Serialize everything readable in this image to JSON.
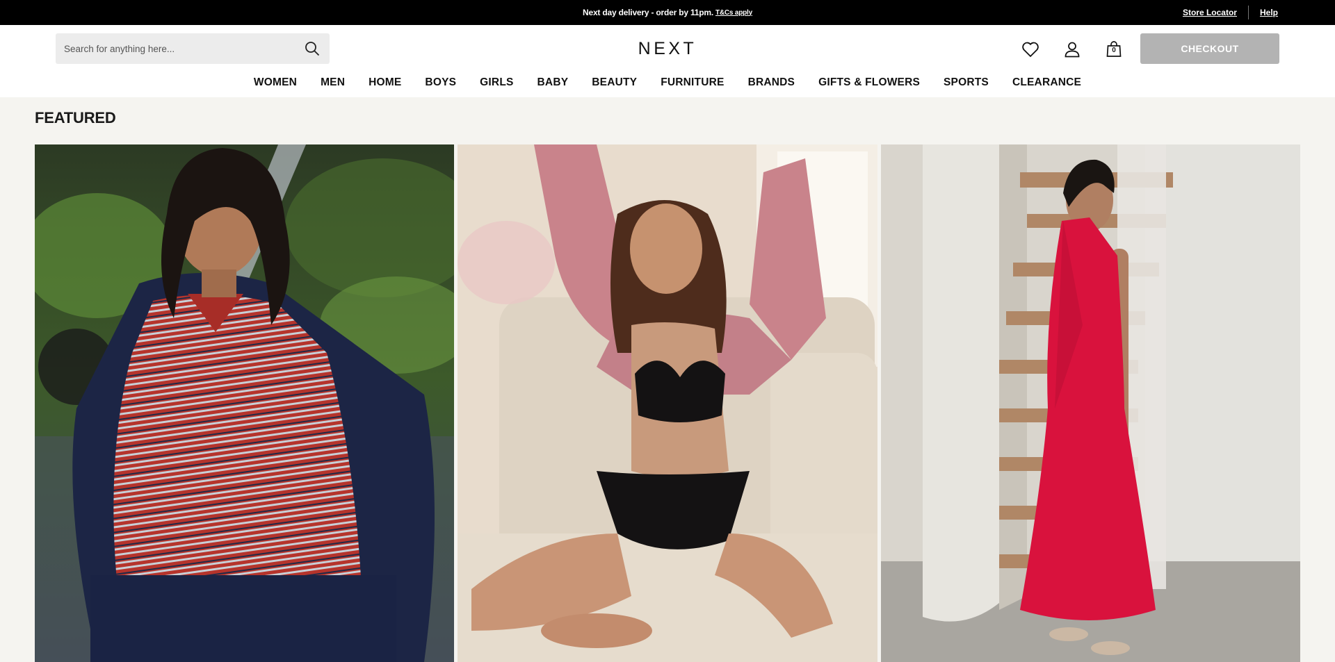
{
  "promo": {
    "message": "Next day delivery - order by 11pm.",
    "terms_link": "T&Cs apply",
    "store_locator": "Store Locator",
    "help": "Help"
  },
  "header": {
    "search_placeholder": "Search for anything here...",
    "logo": "NEXT",
    "bag_count": "0",
    "checkout_label": "CHECKOUT"
  },
  "nav": {
    "items": [
      "WOMEN",
      "MEN",
      "HOME",
      "BOYS",
      "GIRLS",
      "BABY",
      "BEAUTY",
      "FURNITURE",
      "BRANDS",
      "GIFTS & FLOWERS",
      "SPORTS",
      "CLEARANCE"
    ]
  },
  "featured": {
    "title": "FEATURED"
  },
  "colors": {
    "promo_bg": "#000000",
    "page_bg": "#f5f4f0",
    "checkout_disabled": "#b3b3b3"
  }
}
